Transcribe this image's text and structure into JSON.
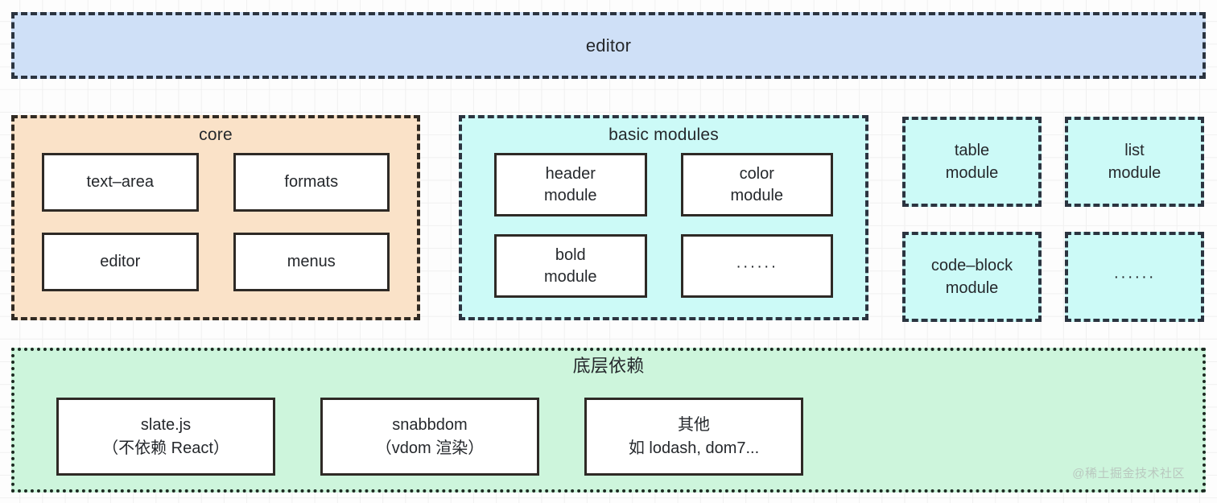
{
  "diagram": {
    "editor_bar": {
      "label": "editor"
    },
    "core": {
      "title": "core",
      "cards": [
        {
          "lines": [
            "text–area"
          ]
        },
        {
          "lines": [
            "formats"
          ]
        },
        {
          "lines": [
            "editor"
          ]
        },
        {
          "lines": [
            "menus"
          ]
        }
      ]
    },
    "basic_modules": {
      "title": "basic modules",
      "cards": [
        {
          "lines": [
            "header",
            "module"
          ]
        },
        {
          "lines": [
            "color",
            "module"
          ]
        },
        {
          "lines": [
            "bold",
            "module"
          ]
        },
        {
          "lines": [
            "······"
          ]
        }
      ]
    },
    "optional_modules": [
      {
        "lines": [
          "table",
          "module"
        ]
      },
      {
        "lines": [
          "list",
          "module"
        ]
      },
      {
        "lines": [
          "code–block",
          "module"
        ]
      },
      {
        "lines": [
          "······"
        ]
      }
    ],
    "dependencies": {
      "title": "底层依赖",
      "cards": [
        {
          "lines": [
            "slate.js",
            "（不依赖 React）"
          ]
        },
        {
          "lines": [
            "snabbdom",
            "（vdom 渲染）"
          ]
        },
        {
          "lines": [
            "其他",
            "如 lodash, dom7..."
          ]
        }
      ]
    },
    "watermark": "@稀土掘金技术社区",
    "colors": {
      "background": "#fdfdfd",
      "grid_line": "#f0f0f0",
      "editor_bar_fill": "#cfe0f7",
      "core_fill": "#fae2c8",
      "module_fill": "#ccfaf7",
      "dependency_fill": "#cdf5dc",
      "border_dark": "#2b3440",
      "card_border": "#2e2a26",
      "text": "#25282c",
      "watermark_text": "#b9c8bf"
    }
  }
}
